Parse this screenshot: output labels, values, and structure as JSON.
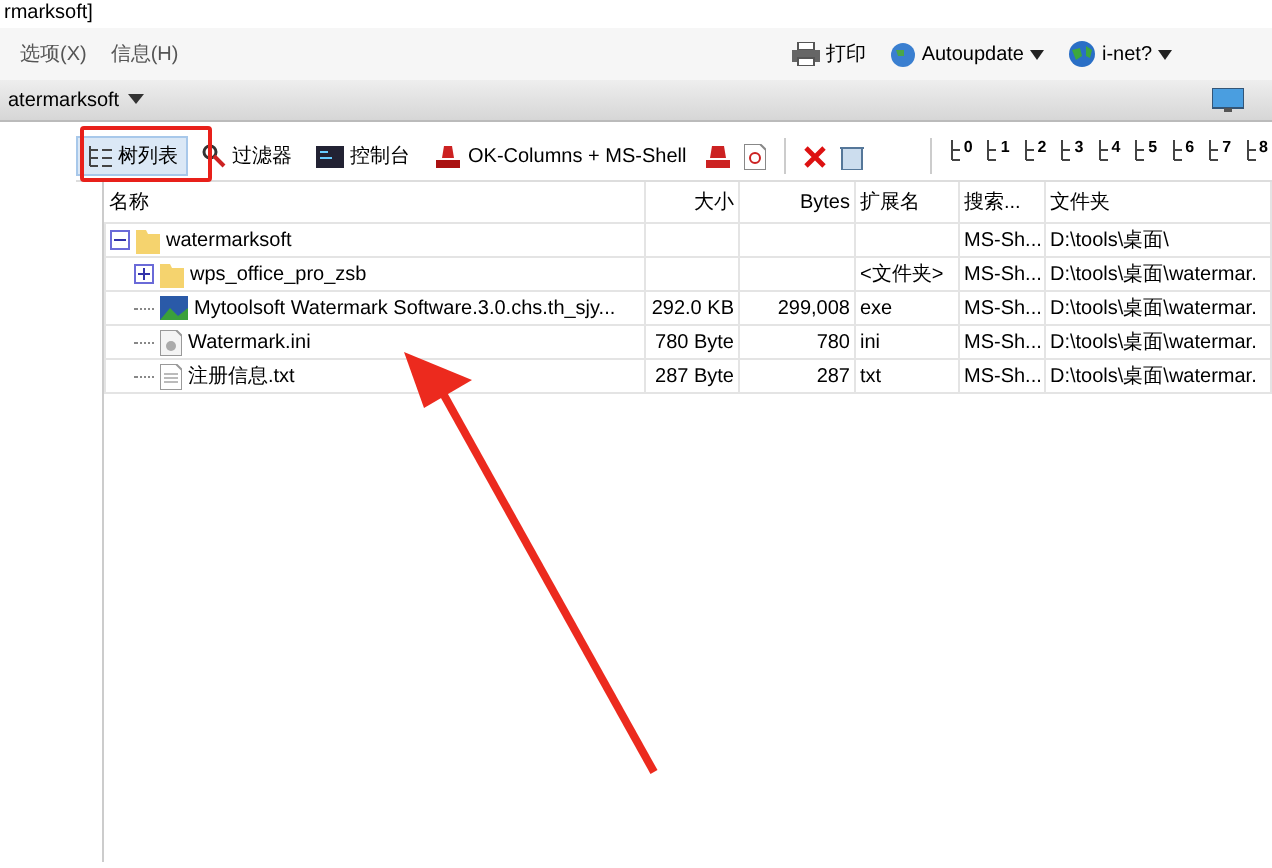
{
  "window": {
    "title": "rmarksoft]"
  },
  "menu": [
    {
      "label": "选项(X)"
    },
    {
      "label": "信息(H)"
    }
  ],
  "top_toolbar": [
    {
      "label": "打印",
      "kind": "print"
    },
    {
      "label": "Autoupdate",
      "kind": "update"
    },
    {
      "label": "i-net?",
      "kind": "net"
    }
  ],
  "address": {
    "value": "atermarksoft"
  },
  "toolbar": [
    {
      "label": "树列表",
      "kind": "tree",
      "selected": true
    },
    {
      "label": "过滤器",
      "kind": "filter",
      "selected": false
    },
    {
      "label": "控制台",
      "kind": "console",
      "selected": false
    },
    {
      "label": "OK-Columns + MS-Shell",
      "kind": "columns",
      "selected": false
    }
  ],
  "level_buttons": [
    "0",
    "1",
    "2",
    "3",
    "4",
    "5",
    "6",
    "7",
    "8"
  ],
  "table": {
    "columns": [
      "名称",
      "大小",
      "Bytes",
      "扩展名",
      "搜索...",
      "文件夹"
    ],
    "rows": [
      {
        "kind": "folder",
        "expanded": true,
        "name": "watermarksoft",
        "search": "MS-Sh...",
        "folder": "D:\\tools\\桌面\\",
        "children": [
          {
            "kind": "folder",
            "expanded": false,
            "name": "wps_office_pro_zsb",
            "ext": "<文件夹>",
            "search": "MS-Sh...",
            "folder": "D:\\tools\\桌面\\watermar."
          },
          {
            "kind": "image",
            "name": "Mytoolsoft Watermark Software.3.0.chs.th_sjy...",
            "size": "292.0 KB",
            "bytes": "299,008",
            "ext": "exe",
            "search": "MS-Sh...",
            "folder": "D:\\tools\\桌面\\watermar."
          },
          {
            "kind": "settings",
            "name": "Watermark.ini",
            "size": "780 Byte",
            "bytes": "780",
            "ext": "ini",
            "search": "MS-Sh...",
            "folder": "D:\\tools\\桌面\\watermar."
          },
          {
            "kind": "text",
            "name": "注册信息.txt",
            "size": "287 Byte",
            "bytes": "287",
            "ext": "txt",
            "search": "MS-Sh...",
            "folder": "D:\\tools\\桌面\\watermar."
          }
        ]
      }
    ]
  }
}
